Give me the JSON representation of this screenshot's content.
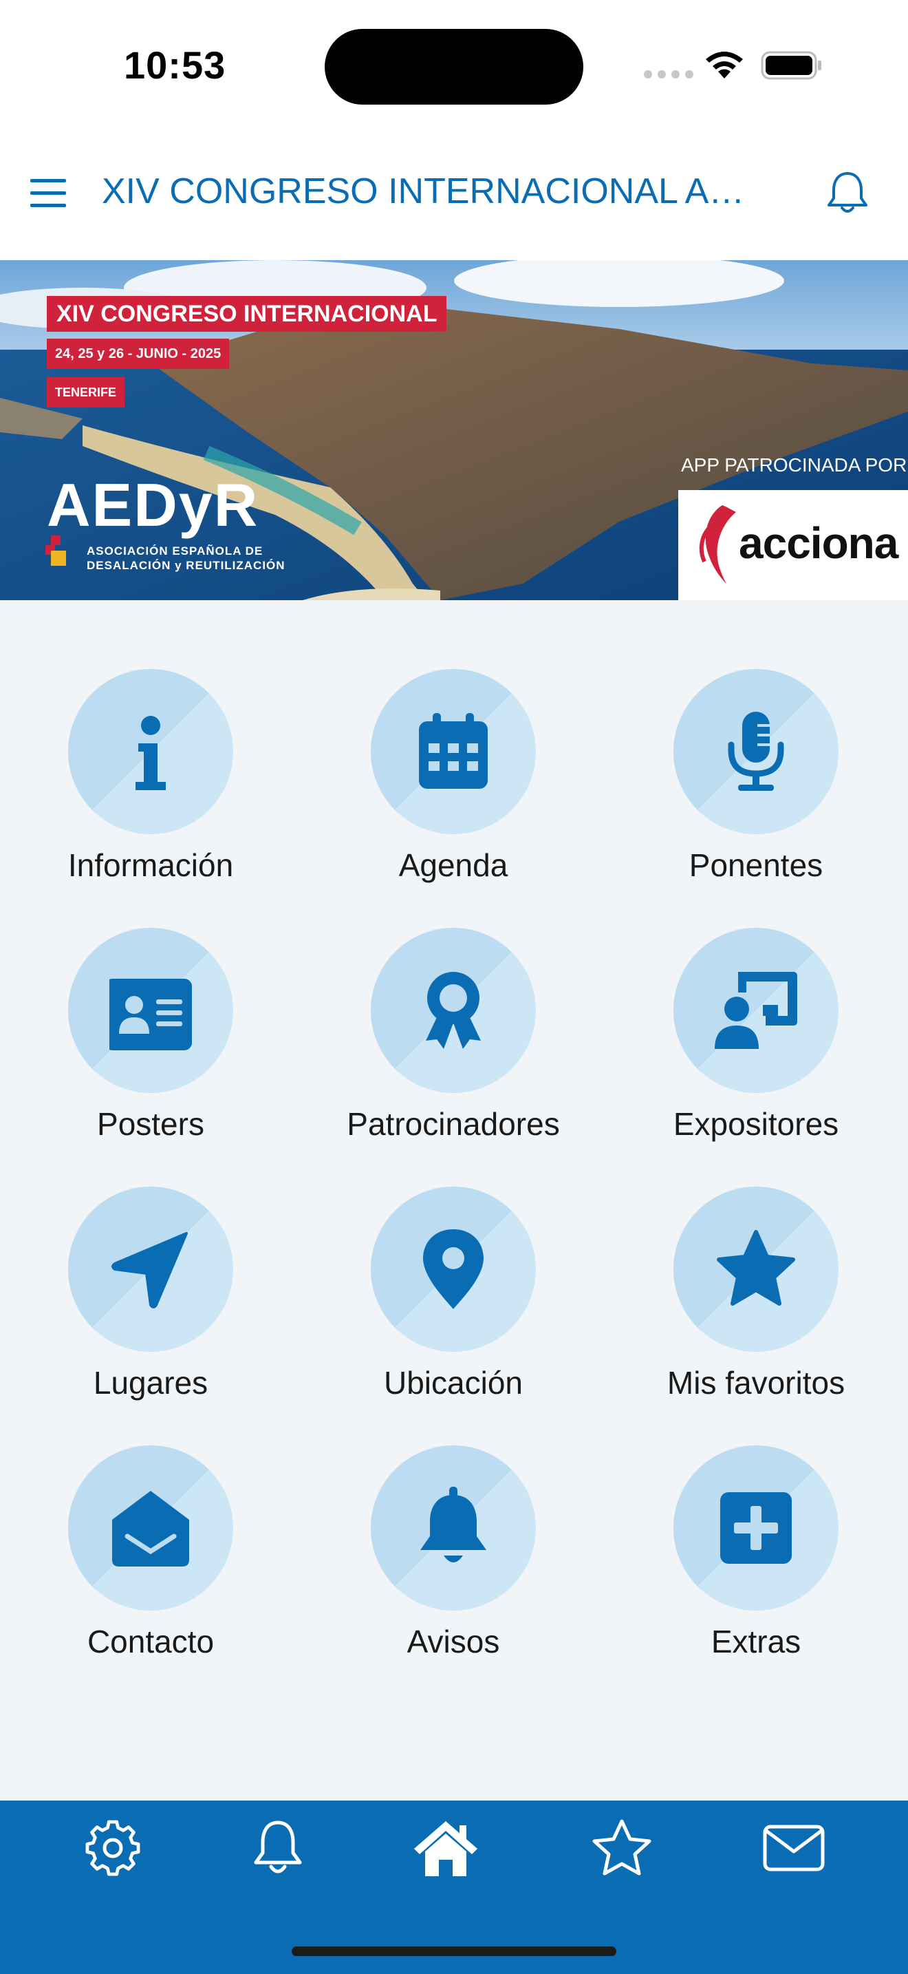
{
  "status_bar": {
    "time": "10:53"
  },
  "header": {
    "title": "XIV CONGRESO INTERNACIONAL AEDyR",
    "menu_icon": "hamburger-icon",
    "bell_icon": "bell-icon"
  },
  "banner": {
    "headline": "XIV CONGRESO INTERNACIONAL",
    "dates": "24, 25 y 26 - JUNIO - 2025",
    "location": "TENERIFE",
    "org_name": "AEDyR",
    "org_subtitle": "ASOCIACIÓN ESPAÑOLA DE DESALACIÓN y REUTILIZACIÓN",
    "sponsored_label": "APP PATROCINADA POR",
    "sponsor": "acciona"
  },
  "colors": {
    "accent": "#0a6db3",
    "tile_bg": "#bcdcf1",
    "page_bg": "#f1f5f8"
  },
  "grid": [
    {
      "label": "Información",
      "icon": "info-icon"
    },
    {
      "label": "Agenda",
      "icon": "calendar-icon"
    },
    {
      "label": "Ponentes",
      "icon": "microphone-icon"
    },
    {
      "label": "Posters",
      "icon": "id-card-icon"
    },
    {
      "label": "Patrocinadores",
      "icon": "award-ribbon-icon"
    },
    {
      "label": "Expositores",
      "icon": "presenter-board-icon"
    },
    {
      "label": "Lugares",
      "icon": "location-arrow-icon"
    },
    {
      "label": "Ubicación",
      "icon": "map-pin-icon"
    },
    {
      "label": "Mis favoritos",
      "icon": "star-icon"
    },
    {
      "label": "Contacto",
      "icon": "envelope-open-icon"
    },
    {
      "label": "Avisos",
      "icon": "bell-icon"
    },
    {
      "label": "Extras",
      "icon": "plus-square-icon"
    }
  ],
  "bottom_nav": [
    {
      "icon": "gear-icon"
    },
    {
      "icon": "bell-icon"
    },
    {
      "icon": "home-icon"
    },
    {
      "icon": "star-icon"
    },
    {
      "icon": "envelope-icon"
    }
  ]
}
